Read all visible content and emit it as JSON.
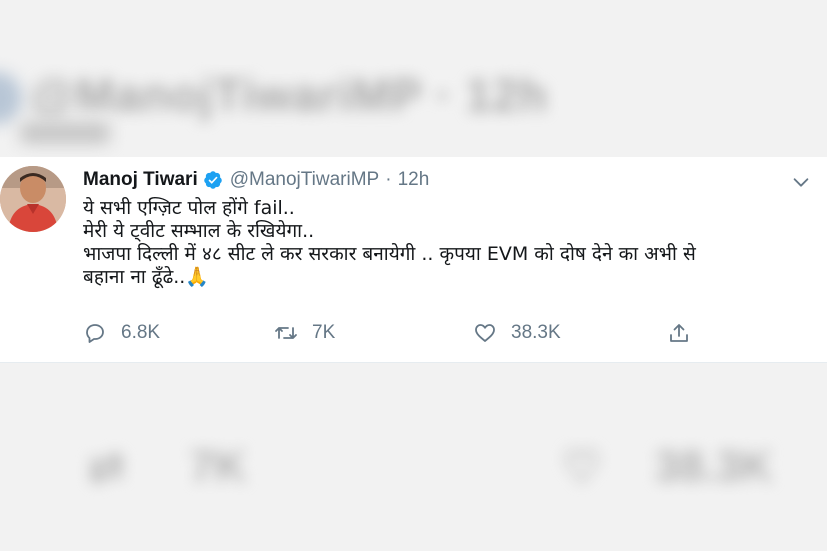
{
  "tweet": {
    "author_name": "Manoj Tiwari",
    "handle": "@ManojTiwariMP",
    "separator": "·",
    "time": "12h",
    "lines": [
      "ये सभी एग्ज़िट पोल होंगे fail..",
      "मेरी ये ट्वीट सम्भाल के रखियेगा..",
      "भाजपा दिल्ली में ४८ सीट ले कर सरकार बनायेगी .. कृपया EVM को दोष देने का अभी से",
      "बहाना ना ढूँढे..🙏"
    ],
    "replies": "6.8K",
    "retweets": "7K",
    "likes": "38.3K"
  },
  "background": {
    "handle": "@ManojTiwariMP · 12h",
    "retweets": "7K",
    "likes": "38.3K"
  },
  "colors": {
    "text": "#14171a",
    "muted": "#657786",
    "verified": "#1da1f2"
  }
}
